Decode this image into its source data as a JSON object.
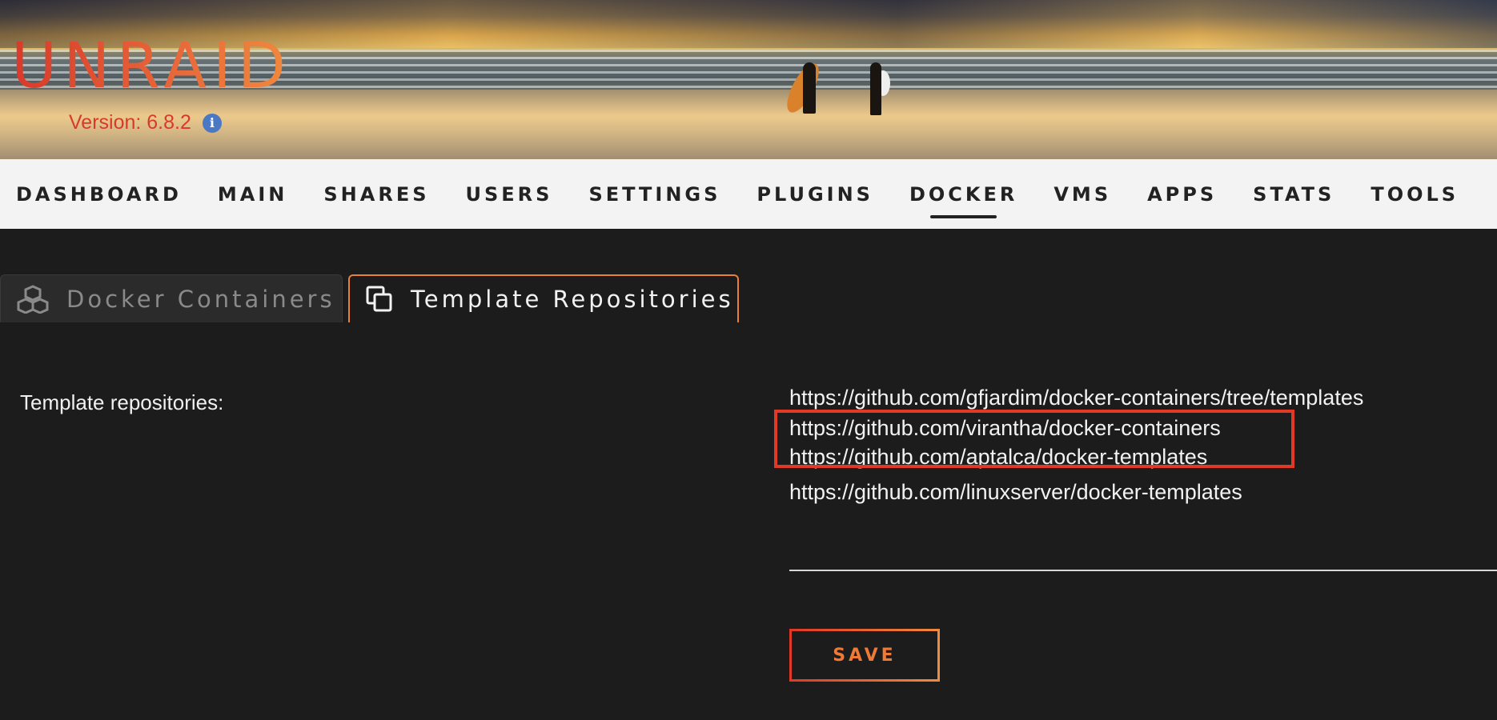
{
  "header": {
    "logo_text": "UNRAID",
    "version_text": "Version: 6.8.2",
    "info_icon": "info-icon"
  },
  "nav": {
    "items": [
      {
        "label": "DASHBOARD"
      },
      {
        "label": "MAIN"
      },
      {
        "label": "SHARES"
      },
      {
        "label": "USERS"
      },
      {
        "label": "SETTINGS"
      },
      {
        "label": "PLUGINS"
      },
      {
        "label": "DOCKER"
      },
      {
        "label": "VMS"
      },
      {
        "label": "APPS"
      },
      {
        "label": "STATS"
      },
      {
        "label": "TOOLS"
      }
    ],
    "active": "DOCKER"
  },
  "tabs": [
    {
      "label": "Docker Containers",
      "icon": "cubes-icon",
      "active": false
    },
    {
      "label": "Template Repositories",
      "icon": "copy-icon",
      "active": true
    }
  ],
  "form": {
    "label": "Template repositories:",
    "repositories": [
      "https://github.com/gfjardim/docker-containers/tree/templates",
      "https://github.com/virantha/docker-containers",
      "https://github.com/aptalca/docker-templates",
      "https://github.com/linuxserver/docker-templates"
    ],
    "save_label": "SAVE"
  },
  "colors": {
    "accent": "#e8803a",
    "highlight_border": "#e03a27",
    "version_red": "#d9392b"
  }
}
